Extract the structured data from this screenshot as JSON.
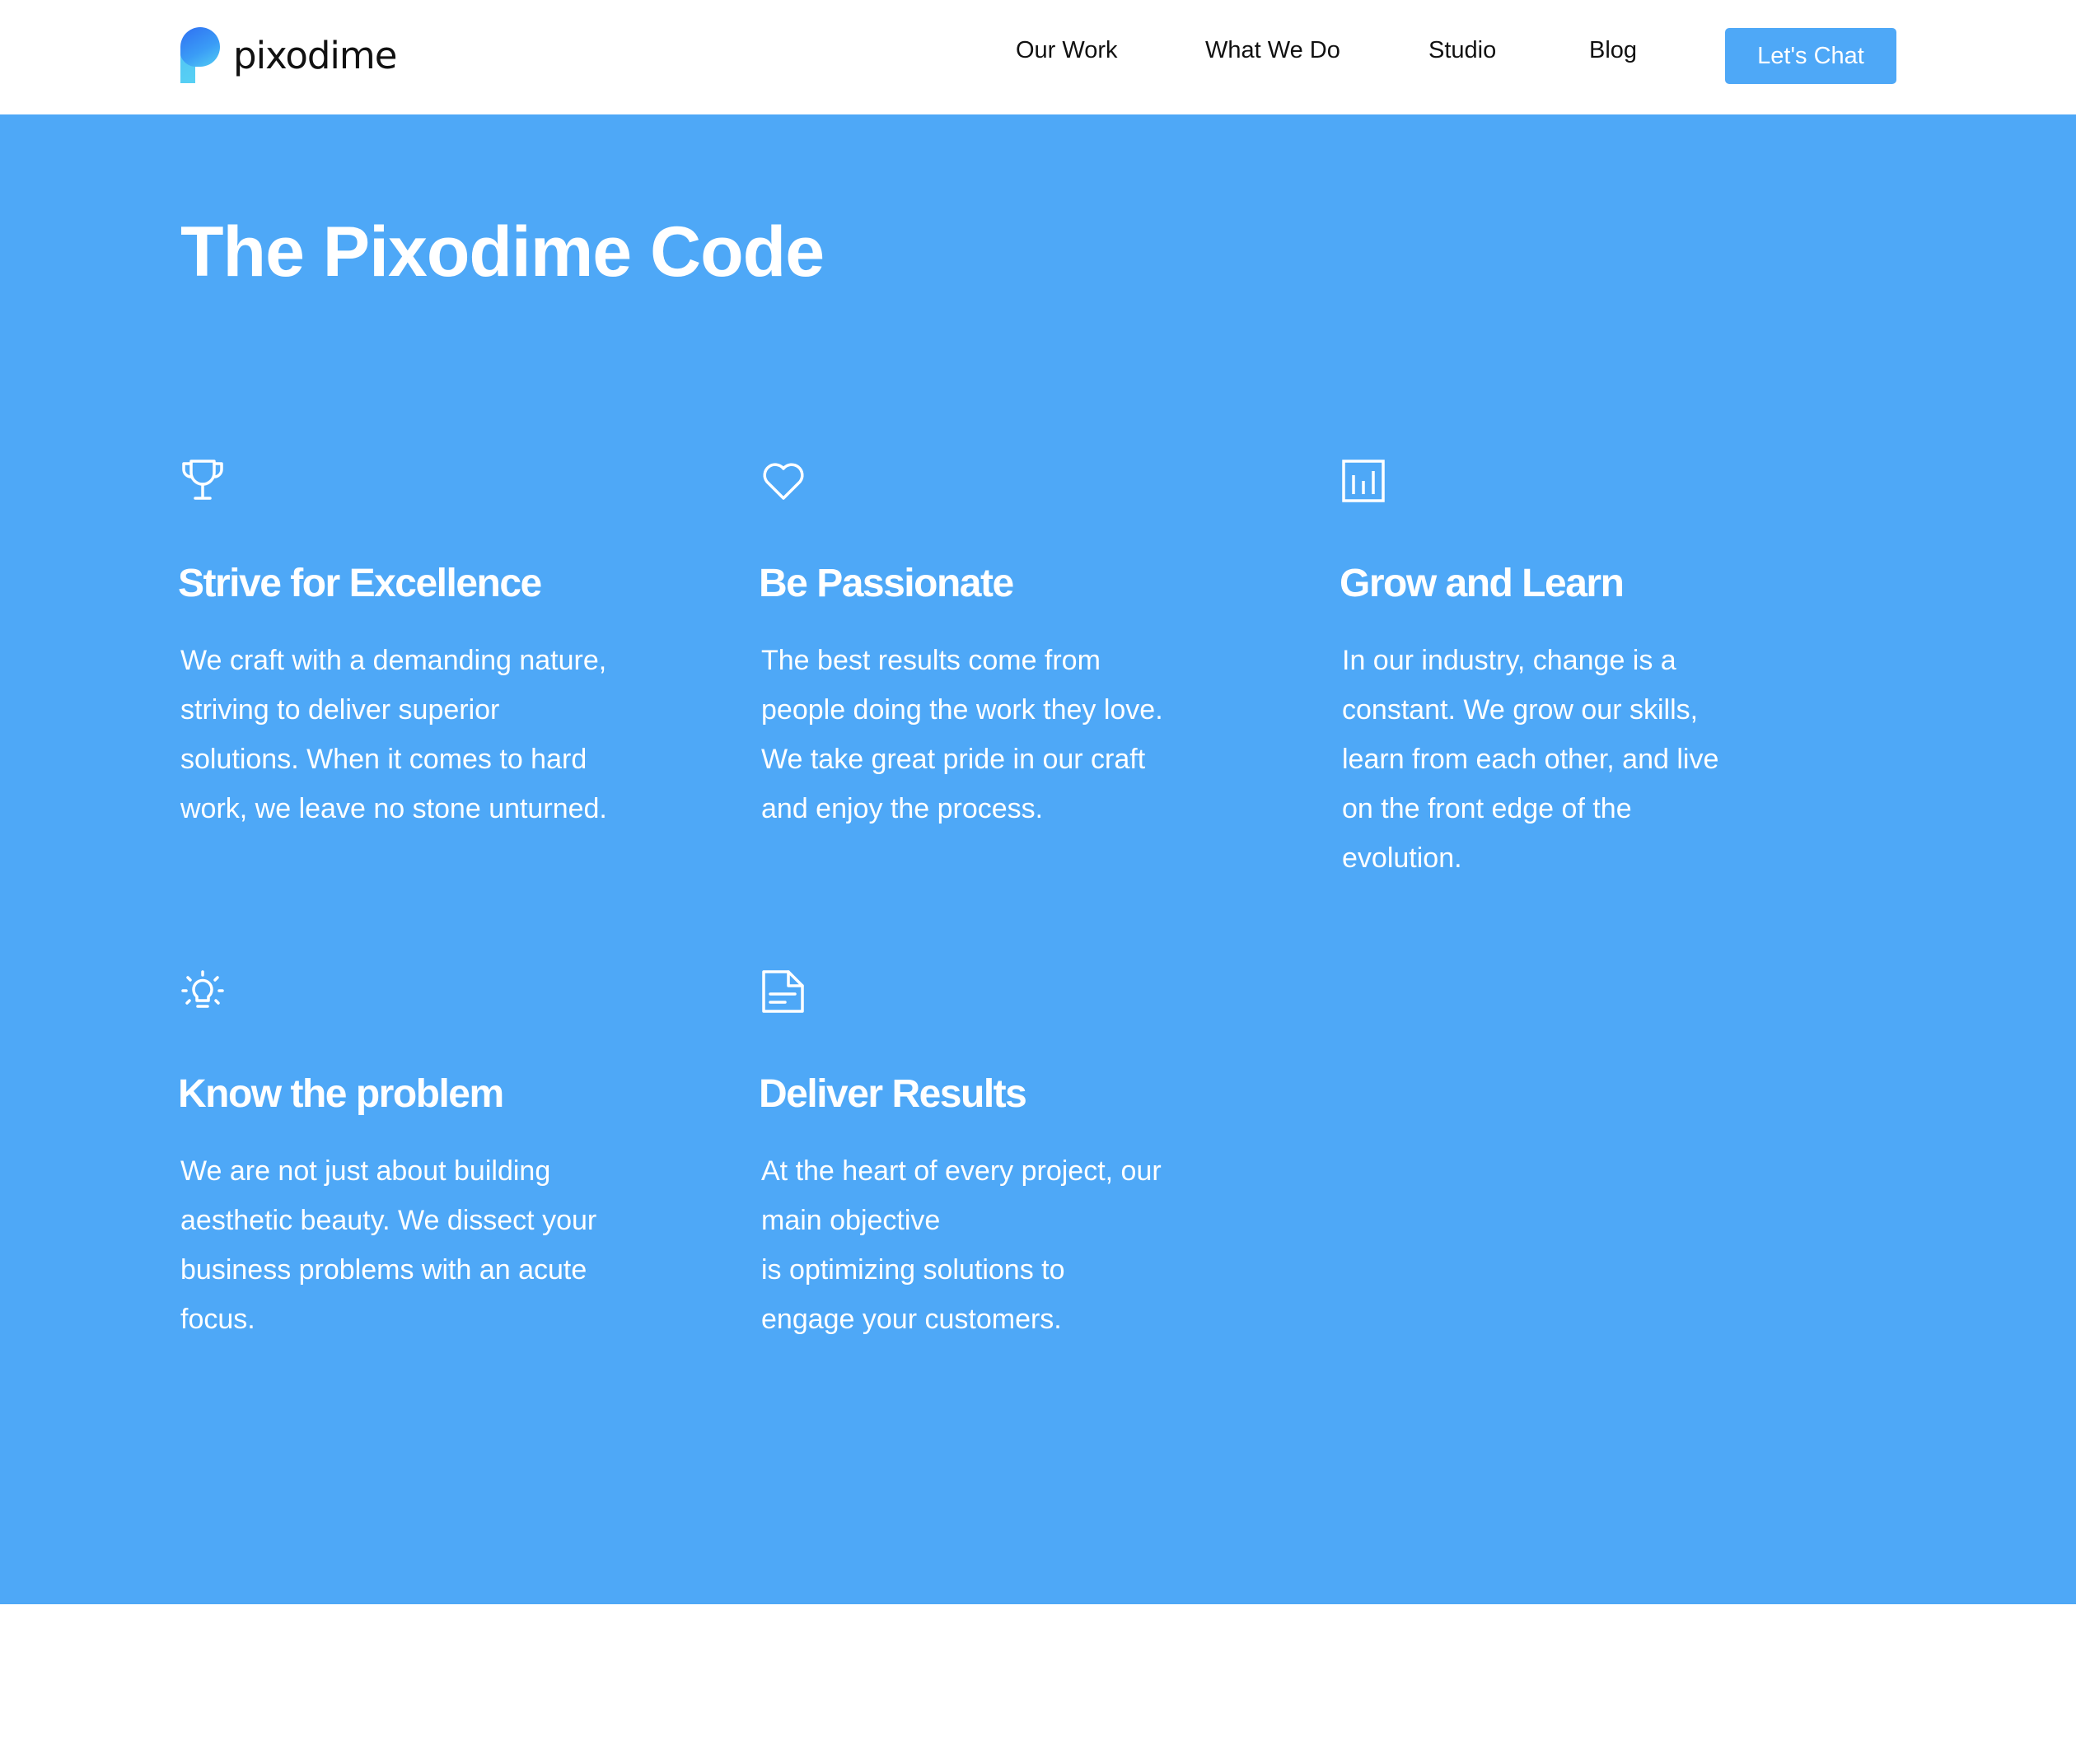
{
  "header": {
    "brand": "pixodime",
    "nav": [
      {
        "label": "Our Work"
      },
      {
        "label": "What We Do"
      },
      {
        "label": "Studio"
      },
      {
        "label": "Blog"
      }
    ],
    "cta_label": "Let's Chat"
  },
  "colors": {
    "accent": "#4ea8f7",
    "text_dark": "#111111",
    "on_accent": "#ffffff"
  },
  "section": {
    "title": "The Pixodime Code",
    "values": [
      {
        "icon": "trophy-icon",
        "title": "Strive for Excellence",
        "lines": [
          "We craft with a demanding nature,",
          "striving to deliver superior",
          "solutions. When it comes to hard",
          "work, we leave no stone unturned."
        ]
      },
      {
        "icon": "heart-icon",
        "title": "Be Passionate",
        "lines": [
          "The best results come from",
          "people doing the work they love.",
          "We take great pride in our craft",
          "and enjoy the process."
        ]
      },
      {
        "icon": "bar-chart-icon",
        "title": "Grow and Learn",
        "lines": [
          "In our industry, change is a",
          "constant. We grow our skills,",
          "learn from each other, and live",
          "on the front edge of the",
          "evolution."
        ]
      },
      {
        "icon": "lightbulb-icon",
        "title": "Know the problem",
        "lines": [
          "We are not just about building",
          "aesthetic beauty. We dissect your",
          "business problems with an acute",
          "focus."
        ]
      },
      {
        "icon": "document-icon",
        "title": "Deliver Results",
        "lines": [
          "At the heart of every project, our",
          "main objective",
          "is optimizing solutions to",
          "engage your customers."
        ]
      }
    ]
  }
}
